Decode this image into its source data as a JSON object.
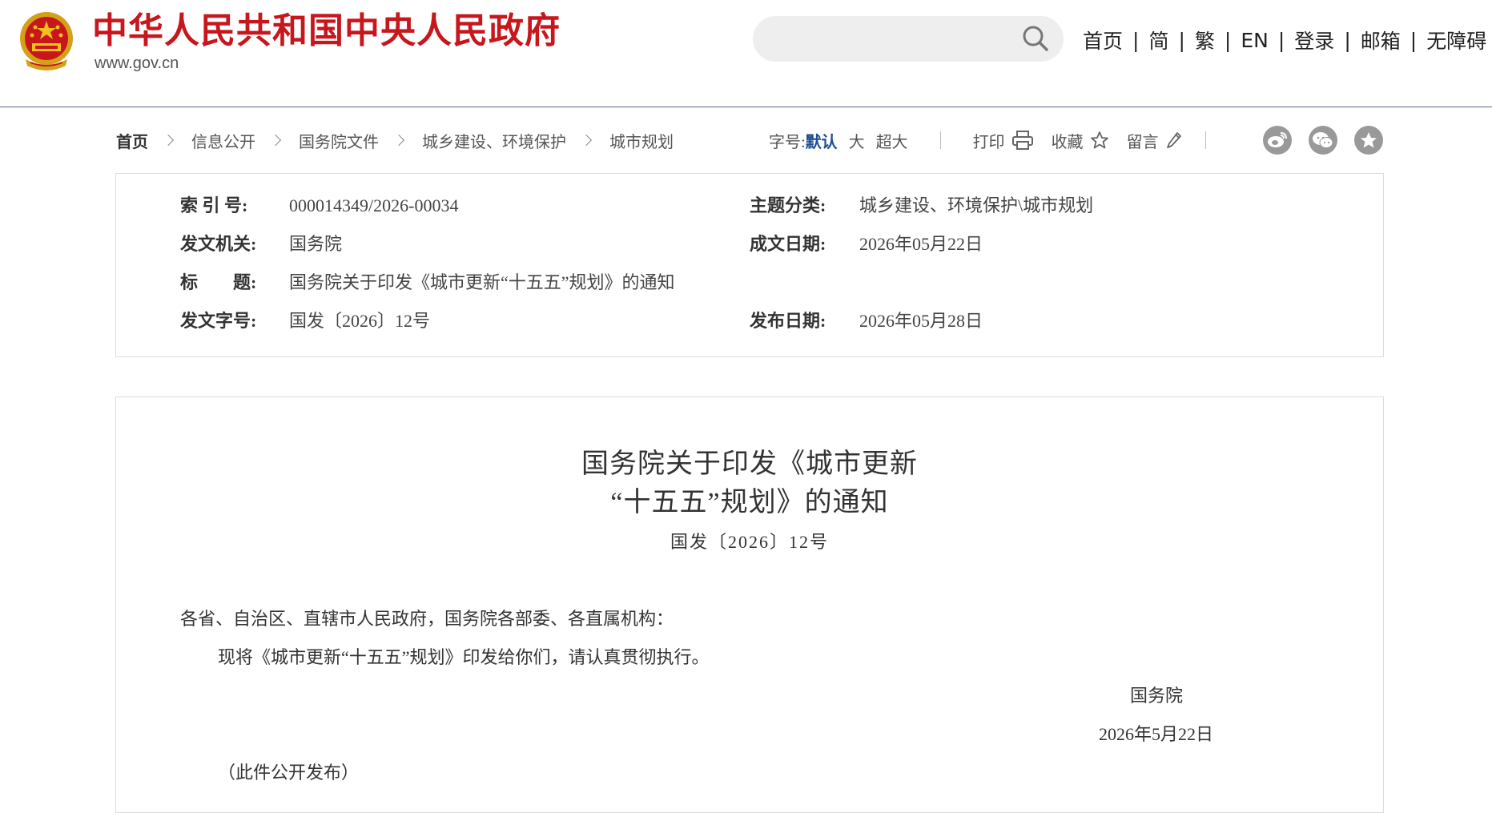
{
  "header": {
    "site_name": "中华人民共和国中央人民政府",
    "site_url": "www.gov.cn",
    "search": {
      "value": "",
      "placeholder": ""
    },
    "nav": [
      "首页",
      "简",
      "繁",
      "EN",
      "登录",
      "邮箱",
      "无障碍"
    ]
  },
  "breadcrumb": [
    "首页",
    "信息公开",
    "国务院文件",
    "城乡建设、环境保护",
    "城市规划"
  ],
  "tools": {
    "font_label": "字号:",
    "font_default": "默认",
    "font_large": "大",
    "font_xlarge": "超大",
    "print": "打印",
    "favorite": "收藏",
    "comment": "留言"
  },
  "share_icons": [
    "weibo-icon",
    "wechat-icon",
    "star-share-icon"
  ],
  "info": {
    "index_label": "索 引 号:",
    "index_value": "000014349/2026-00034",
    "topic_label": "主题分类:",
    "topic_value": "城乡建设、环境保护\\城市规划",
    "issuer_label": "发文机关:",
    "issuer_value": "国务院",
    "written_label": "成文日期:",
    "written_value": "2026年05月22日",
    "title_label": "标　　题:",
    "title_value": "国务院关于印发《城市更新“十五五”规划》的通知",
    "docno_label": "发文字号:",
    "docno_value": "国发〔2026〕12号",
    "published_label": "发布日期:",
    "published_value": "2026年05月28日"
  },
  "document": {
    "title_line1": "国务院关于印发《城市更新",
    "title_line2": "“十五五”规划》的通知",
    "doc_number": "国发〔2026〕12号",
    "salutation": "各省、自治区、直辖市人民政府，国务院各部委、各直属机构：",
    "body": "现将《城市更新“十五五”规划》印发给你们，请认真贯彻执行。",
    "signature": "国务院",
    "date": "2026年5月22日",
    "note": "（此件公开发布）"
  },
  "colors": {
    "brand_red": "#c8161d",
    "link_blue": "#1e4f91",
    "header_rule": "#5a6b88",
    "share_grey": "#999999"
  }
}
